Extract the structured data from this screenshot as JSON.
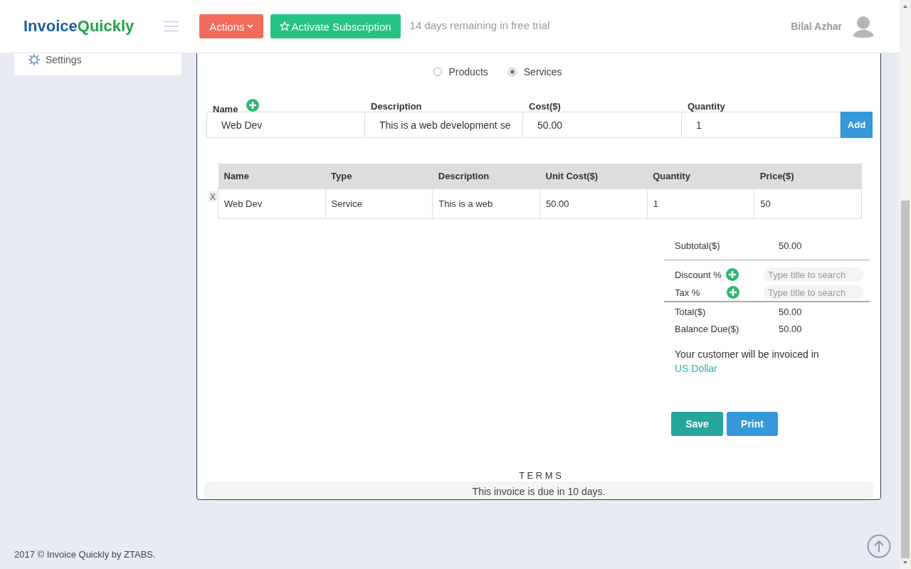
{
  "header": {
    "logo_first": "Invoice",
    "logo_second": "Quickly",
    "actions_button": "Actions",
    "subscribe_button": "Activate Subscription",
    "trial_notice": "14 days remaining in free trial",
    "user_name": "Bilal Azhar"
  },
  "sidebar": {
    "items": [
      {
        "label": "Settings"
      }
    ]
  },
  "item_type": [
    {
      "label": "Products",
      "selected": false
    },
    {
      "label": "Services",
      "selected": true
    }
  ],
  "entry": {
    "columns": [
      "Name",
      "Description",
      "Cost($)",
      "Quantity"
    ],
    "values": [
      "Web Dev",
      "This is a web development se",
      "50.00",
      "1"
    ],
    "add_button": "Add"
  },
  "table": {
    "columns": [
      "Name",
      "Type",
      "Description",
      "Unit Cost($)",
      "Quantity",
      "Price($)"
    ],
    "rows": [
      {
        "remove": "X",
        "cells": [
          "Web Dev",
          "Service",
          "This is a web",
          "50.00",
          "1",
          "50"
        ]
      }
    ]
  },
  "summary": {
    "subtotal_label": "Subtotal($)",
    "subtotal": "50.00",
    "discount_label": "Discount %",
    "discount_placeholder": "Type title to search",
    "tax_label": "Tax %",
    "tax_placeholder": "Type title to search",
    "total_label": "Total($)",
    "total": "50.00",
    "balance_label": "Balance Due($)",
    "balance": "50.00",
    "currency_note": "Your customer will be invoiced in",
    "currency": "US Dollar"
  },
  "buttons": [
    {
      "kind": "save",
      "label": "Save"
    },
    {
      "kind": "print",
      "label": "Print"
    }
  ],
  "terms": {
    "title": "T E R M S",
    "text": "This invoice is due in 10 days."
  },
  "footer": "2017 © Invoice Quickly by ZTABS."
}
